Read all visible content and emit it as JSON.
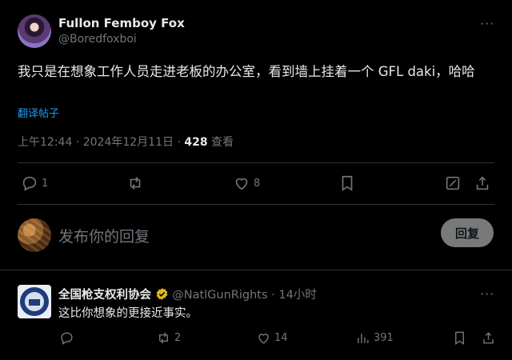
{
  "post": {
    "author_name": "Fullon Femboy Fox",
    "author_handle": "@Boredfoxboi",
    "text": "我只是在想象工作人员走进老板的办公室，看到墙上挂着一个 GFL daki，哈哈",
    "translate_label": "翻译帖子",
    "time": "上午12:44",
    "date": "2024年12月11日",
    "views_count": "428",
    "views_label": "查看",
    "separator": "·",
    "more_label": "···",
    "actions": {
      "replies": "1",
      "reposts": "",
      "likes": "8"
    }
  },
  "composer": {
    "placeholder": "发布你的回复",
    "reply_button": "回复"
  },
  "reply": {
    "author_name": "全国枪支权利协会",
    "author_handle": "@NatlGunRights",
    "separator": "·",
    "time": "14小时",
    "more_label": "···",
    "text": "这比你想象的更接近事实。",
    "actions": {
      "replies": "",
      "reposts": "2",
      "likes": "14",
      "views": "391"
    }
  },
  "colors": {
    "background": "#000000",
    "text": "#e7e9ea",
    "muted": "#71767b",
    "link": "#1d9bf0",
    "divider": "#2f3336",
    "verified_gold": "#e2b719"
  },
  "icons": [
    "more-icon",
    "reply-icon",
    "repost-icon",
    "like-icon",
    "bookmark-icon",
    "grok-icon",
    "share-icon",
    "views-icon",
    "verified-badge-icon"
  ]
}
